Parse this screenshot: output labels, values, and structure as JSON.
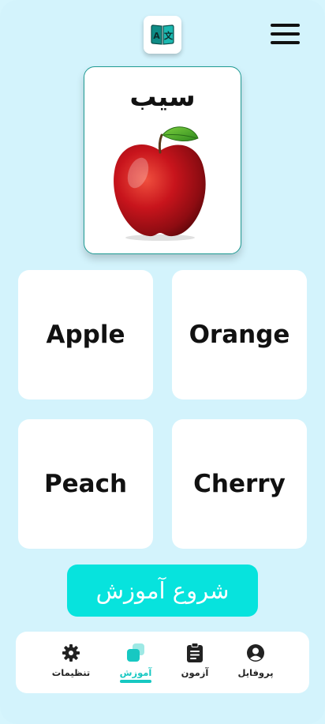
{
  "header": {
    "logo_icon": "translate-book-icon",
    "menu_icon": "hamburger-menu-icon"
  },
  "flashcard": {
    "word": "سیب",
    "image": "red-apple"
  },
  "options": [
    {
      "label": "Apple"
    },
    {
      "label": "Orange"
    },
    {
      "label": "Peach"
    },
    {
      "label": "Cherry"
    }
  ],
  "start_button": {
    "label": "شروع آموزش"
  },
  "bottom_nav": {
    "items": [
      {
        "label": "پروفایل",
        "icon": "user-circle-icon"
      },
      {
        "label": "آزمون",
        "icon": "clipboard-icon"
      },
      {
        "label": "آموزش",
        "icon": "learning-cards-icon",
        "active": true
      },
      {
        "label": "تنظیمات",
        "icon": "gear-icon"
      }
    ]
  },
  "colors": {
    "background": "#d3f3fc",
    "accent": "#07e3dd",
    "active_nav": "#17c8c2",
    "card_border": "#1e9a93"
  }
}
